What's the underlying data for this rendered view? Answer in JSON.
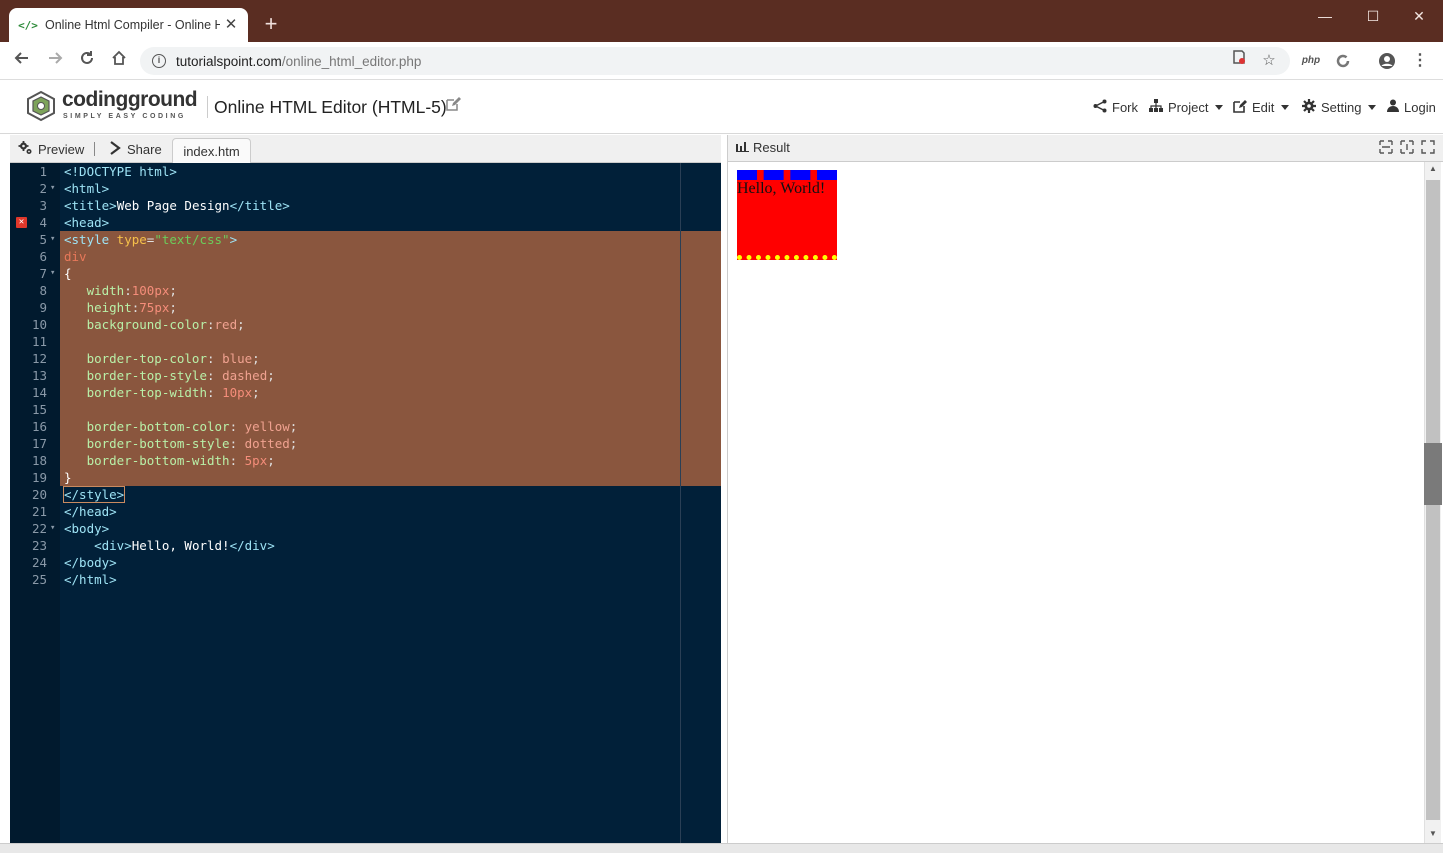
{
  "browser": {
    "tab_title": "Online Html Compiler - Online H",
    "tab_favicon": "</>",
    "close_glyph": "✕",
    "newtab_glyph": "+",
    "url_host": "tutorialspoint.com",
    "url_path": "/online_html_editor.php",
    "ext_php_label": "php",
    "window_controls": {
      "minimize": "—",
      "maximize": "☐",
      "close": "✕"
    }
  },
  "header": {
    "logo_word": "codingground",
    "logo_tag": "SIMPLY EASY CODING",
    "editor_title": "Online HTML Editor (HTML-5)",
    "menu": {
      "fork": "Fork",
      "project": "Project",
      "edit": "Edit",
      "setting": "Setting",
      "login": "Login"
    }
  },
  "left_toolbar": {
    "preview": "Preview",
    "share": "Share",
    "file_tab": "index.htm"
  },
  "editor": {
    "colors": {
      "background": "#012039",
      "selection": "#8a563e"
    },
    "error_line": 4,
    "lines": [
      "1",
      "2",
      "3",
      "4",
      "5",
      "6",
      "7",
      "8",
      "9",
      "10",
      "11",
      "12",
      "13",
      "14",
      "15",
      "16",
      "17",
      "18",
      "19",
      "20",
      "21",
      "22",
      "23",
      "24",
      "25"
    ],
    "code": {
      "l1": "<!DOCTYPE html>",
      "l2": "<html>",
      "l3a": "<title>",
      "l3b": "Web Page Design",
      "l3c": "</title>",
      "l4": "<head>",
      "l5a": "<style",
      "l5b": " type",
      "l5c": "=",
      "l5d": "\"text/css\"",
      "l5e": ">",
      "l6": "div",
      "l7": "{",
      "l8a": "   width",
      "l8b": ":",
      "l8c": "100px",
      "l8d": ";",
      "l9a": "   height",
      "l9b": ":",
      "l9c": "75px",
      "l9d": ";",
      "l10a": "   background-color",
      "l10b": ":",
      "l10c": "red",
      "l10d": ";",
      "l12a": "   border-top-color",
      "l12b": ": ",
      "l12c": "blue",
      "l12d": ";",
      "l13a": "   border-top-style",
      "l13b": ": ",
      "l13c": "dashed",
      "l13d": ";",
      "l14a": "   border-top-width",
      "l14b": ": ",
      "l14c": "10px",
      "l14d": ";",
      "l16a": "   border-bottom-color",
      "l16b": ": ",
      "l16c": "yellow",
      "l16d": ";",
      "l17a": "   border-bottom-style",
      "l17b": ": ",
      "l17c": "dotted",
      "l17d": ";",
      "l18a": "   border-bottom-width",
      "l18b": ": ",
      "l18c": "5px",
      "l18d": ";",
      "l19": "}",
      "l20": "</style>",
      "l21": "</head>",
      "l22": "<body>",
      "l23a": "    <div>",
      "l23b": "Hello, World!",
      "l23c": "</div>",
      "l24": "</body>",
      "l25": "</html>"
    }
  },
  "result_panel": {
    "label": "Result",
    "rendered_text": "Hello, World!"
  }
}
